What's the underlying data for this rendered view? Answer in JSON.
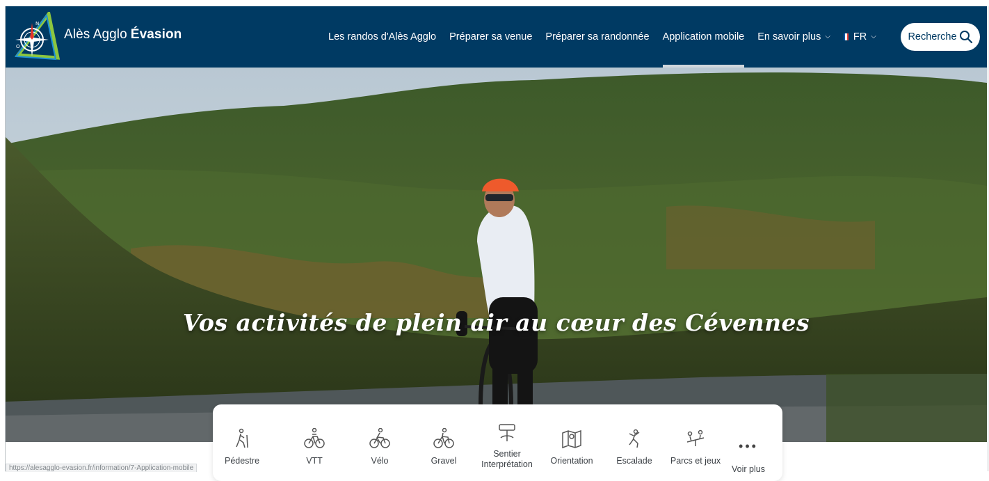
{
  "brand": {
    "name_regular": "Alès Agglo",
    "name_bold": "Évasion"
  },
  "nav": {
    "items": [
      {
        "label": "Les randos d'Alès Agglo"
      },
      {
        "label": "Préparer sa venue"
      },
      {
        "label": "Préparer sa randonnée"
      },
      {
        "label": "Application mobile",
        "active": true
      },
      {
        "label": "En savoir plus",
        "dropdown": true
      },
      {
        "label": "FR",
        "dropdown": true
      }
    ],
    "search_label": "Recherche"
  },
  "hero": {
    "title": "Vos activités de plein air au cœur des Cévennes"
  },
  "activities": [
    {
      "label": "Pédestre",
      "icon": "hiker-icon"
    },
    {
      "label": "VTT",
      "icon": "mountain-bike-icon"
    },
    {
      "label": "Vélo",
      "icon": "cyclist-icon"
    },
    {
      "label": "Gravel",
      "icon": "gravel-bike-icon"
    },
    {
      "label_line1": "Sentier",
      "label_line2": "Interprétation",
      "icon": "signpost-icon"
    },
    {
      "label": "Orientation",
      "icon": "map-icon"
    },
    {
      "label": "Escalade",
      "icon": "climber-icon"
    },
    {
      "label": "Parcs et jeux",
      "icon": "playground-icon"
    },
    {
      "label": "Voir plus",
      "icon": "more-dots-icon",
      "dots": "•••"
    }
  ],
  "status_url": "https://alesagglo-evasion.fr/information/7-Application-mobile",
  "colors": {
    "header_bg": "#003a63",
    "accent_red": "#e63329",
    "accent_green": "#8cc63f",
    "accent_blue": "#1e90d6"
  }
}
